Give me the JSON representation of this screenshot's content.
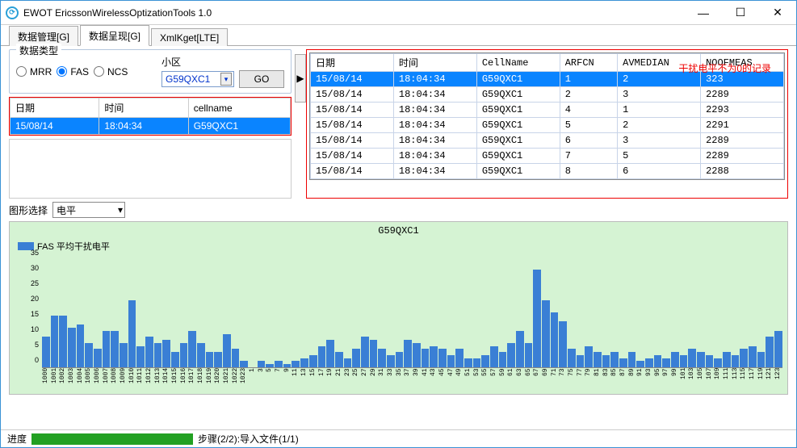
{
  "window": {
    "title": "EWOT EricssonWirelessOptizationTools 1.0",
    "logo_text": "⟳"
  },
  "tabs": {
    "t0": "数据管理[G]",
    "t1": "数据呈现[G]",
    "t2": "XmlKget[LTE]"
  },
  "type_group": {
    "title": "数据类型",
    "mrr": "MRR",
    "fas": "FAS",
    "ncs": "NCS"
  },
  "xiaoqu": {
    "label": "小区",
    "value": "G59QXC1",
    "go": "GO"
  },
  "small_table": {
    "h0": "日期",
    "h1": "时间",
    "h2": "cellname",
    "r0c0": "15/08/14",
    "r0c1": "18:04:34",
    "r0c2": "G59QXC1"
  },
  "big_table": {
    "h0": "日期",
    "h1": "时间",
    "h2": "CellName",
    "h3": "ARFCN",
    "h4": "AVMEDIAN",
    "h5": "NOOFMEAS",
    "rows": [
      {
        "c0": "15/08/14",
        "c1": "18:04:34",
        "c2": "G59QXC1",
        "c3": "1",
        "c4": "2",
        "c5": "323"
      },
      {
        "c0": "15/08/14",
        "c1": "18:04:34",
        "c2": "G59QXC1",
        "c3": "2",
        "c4": "3",
        "c5": "2289"
      },
      {
        "c0": "15/08/14",
        "c1": "18:04:34",
        "c2": "G59QXC1",
        "c3": "4",
        "c4": "1",
        "c5": "2293"
      },
      {
        "c0": "15/08/14",
        "c1": "18:04:34",
        "c2": "G59QXC1",
        "c3": "5",
        "c4": "2",
        "c5": "2291"
      },
      {
        "c0": "15/08/14",
        "c1": "18:04:34",
        "c2": "G59QXC1",
        "c3": "6",
        "c4": "3",
        "c5": "2289"
      },
      {
        "c0": "15/08/14",
        "c1": "18:04:34",
        "c2": "G59QXC1",
        "c3": "7",
        "c4": "5",
        "c5": "2289"
      },
      {
        "c0": "15/08/14",
        "c1": "18:04:34",
        "c2": "G59QXC1",
        "c3": "8",
        "c4": "6",
        "c5": "2288"
      }
    ],
    "annotation": "干扰电平不为0的记录"
  },
  "chart_select": {
    "label": "图形选择",
    "value": "电平"
  },
  "status": {
    "label": "进度",
    "progress_pct": 100,
    "text": "步骤(2/2):导入文件(1/1)"
  },
  "expander_glyph": "▶",
  "combo_arrow": "▾",
  "chart_data": {
    "type": "bar",
    "title": "G59QXC1",
    "legend": "FAS 平均干扰电平",
    "ylabel": "",
    "xlabel": "",
    "ylim": [
      0,
      35
    ],
    "yticks": [
      0,
      5,
      10,
      15,
      20,
      25,
      30,
      35
    ],
    "categories": [
      "1000",
      "1001",
      "1002",
      "1003",
      "1004",
      "1005",
      "1006",
      "1007",
      "1008",
      "1009",
      "1010",
      "1011",
      "1012",
      "1013",
      "1014",
      "1015",
      "1016",
      "1017",
      "1018",
      "1019",
      "1020",
      "1021",
      "1022",
      "1023",
      "1",
      "3",
      "5",
      "7",
      "9",
      "11",
      "13",
      "15",
      "17",
      "19",
      "21",
      "23",
      "25",
      "27",
      "29",
      "31",
      "33",
      "35",
      "37",
      "39",
      "41",
      "43",
      "45",
      "47",
      "49",
      "51",
      "53",
      "55",
      "57",
      "59",
      "61",
      "63",
      "65",
      "67",
      "69",
      "71",
      "73",
      "75",
      "77",
      "79",
      "81",
      "83",
      "85",
      "87",
      "89",
      "91",
      "93",
      "95",
      "97",
      "99",
      "101",
      "103",
      "105",
      "107",
      "109",
      "111",
      "113",
      "115",
      "117",
      "119",
      "121",
      "123"
    ],
    "values": [
      10,
      17,
      17,
      13,
      14,
      8,
      6,
      12,
      12,
      8,
      22,
      7,
      10,
      8,
      9,
      5,
      8,
      12,
      8,
      5,
      5,
      11,
      6,
      2,
      0,
      2,
      1,
      2,
      1,
      2,
      3,
      4,
      7,
      9,
      5,
      3,
      6,
      10,
      9,
      6,
      4,
      5,
      9,
      8,
      6,
      7,
      6,
      4,
      6,
      3,
      3,
      4,
      7,
      5,
      8,
      12,
      8,
      32,
      22,
      18,
      15,
      6,
      4,
      7,
      5,
      4,
      5,
      3,
      5,
      2,
      3,
      4,
      3,
      5,
      4,
      6,
      5,
      4,
      3,
      5,
      4,
      6,
      7,
      5,
      10,
      12
    ]
  }
}
